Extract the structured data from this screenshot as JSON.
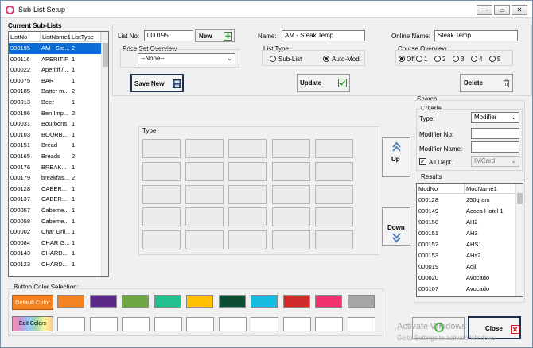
{
  "window": {
    "title": "Sub-List Setup",
    "controls": [
      "—",
      "▭",
      "✕"
    ]
  },
  "sublists": {
    "title": "Current Sub-Lists",
    "columns": [
      "ListNo",
      "ListName1",
      "ListType"
    ],
    "rows": [
      {
        "no": "000195",
        "name": "AM - Ste...",
        "type": "2",
        "selected": true
      },
      {
        "no": "000116",
        "name": "APERITIF",
        "type": "1"
      },
      {
        "no": "000022",
        "name": "Aperitif /...",
        "type": "1"
      },
      {
        "no": "000075",
        "name": "BAR",
        "type": "1"
      },
      {
        "no": "000185",
        "name": "Batter m...",
        "type": "2"
      },
      {
        "no": "000013",
        "name": "Beer",
        "type": "1"
      },
      {
        "no": "000186",
        "name": "Ben Imp...",
        "type": "2"
      },
      {
        "no": "000031",
        "name": "Bourbons",
        "type": "1"
      },
      {
        "no": "000103",
        "name": "BOURB...",
        "type": "1"
      },
      {
        "no": "000151",
        "name": "Bread",
        "type": "1"
      },
      {
        "no": "000165",
        "name": "Breads",
        "type": "2"
      },
      {
        "no": "000176",
        "name": "BREAK...",
        "type": "1"
      },
      {
        "no": "000179",
        "name": "breakfas...",
        "type": "2"
      },
      {
        "no": "000128",
        "name": "CABER...",
        "type": "1"
      },
      {
        "no": "000137",
        "name": "CABER...",
        "type": "1"
      },
      {
        "no": "000057",
        "name": "Cabeme...",
        "type": "1"
      },
      {
        "no": "000058",
        "name": "Cabeme...",
        "type": "1"
      },
      {
        "no": "000002",
        "name": "Char Gril...",
        "type": "1"
      },
      {
        "no": "000084",
        "name": "CHAR G...",
        "type": "1"
      },
      {
        "no": "000143",
        "name": "CHARD...",
        "type": "1"
      },
      {
        "no": "000123",
        "name": "CHARD...",
        "type": "1"
      }
    ]
  },
  "form": {
    "list_no_label": "List No:",
    "list_no_value": "000195",
    "new_label": "New",
    "name_label": "Name:",
    "name_value": "AM - Steak Temp",
    "online_name_label": "Online Name:",
    "online_name_value": "Steak Temp",
    "price_set_label": "Price Set Overview",
    "price_set_value": "--None--",
    "list_type_label": "List Type",
    "list_type_options": [
      "Sub-List",
      "Auto-Modi"
    ],
    "list_type_selected": "Auto-Modi",
    "course_label": "Course Overview",
    "course_options": [
      "Off",
      "1",
      "2",
      "3",
      "4",
      "5"
    ],
    "course_selected": "Off"
  },
  "buttons": {
    "save_new": "Save New",
    "update": "Update",
    "delete": "Delete",
    "up": "Up",
    "down": "Down",
    "close": "Close"
  },
  "type_grid": {
    "label": "Type"
  },
  "search": {
    "title": "Search",
    "criteria_label": "Criteria",
    "type_label": "Type:",
    "type_value": "Modifier",
    "modifier_no_label": "Modifier No:",
    "modifier_name_label": "Modifier Name:",
    "all_dept_label": "All Dept.",
    "all_dept_checked": true,
    "dept_value": "IMCard"
  },
  "results": {
    "title": "Results",
    "columns": [
      "ModNo",
      "ModName1"
    ],
    "rows": [
      {
        "no": "000128",
        "name": "250gram"
      },
      {
        "no": "000149",
        "name": "Acoca Hotel 1"
      },
      {
        "no": "000150",
        "name": "AH2"
      },
      {
        "no": "000151",
        "name": "AH3"
      },
      {
        "no": "000152",
        "name": "AHS1"
      },
      {
        "no": "000153",
        "name": "AHs2"
      },
      {
        "no": "000019",
        "name": "Aoili"
      },
      {
        "no": "000020",
        "name": "Avocado"
      },
      {
        "no": "000107",
        "name": "Avocado"
      }
    ]
  },
  "colors": {
    "label": "Button Color Selection:",
    "default_label": "Default Color",
    "edit_label": "Edit Colors",
    "swatches": [
      "#f58220",
      "#5b2a86",
      "#6ea644",
      "#22bf8f",
      "#ffc000",
      "#0d4d32",
      "#17bde0",
      "#d12c2c",
      "#f0326e",
      "#a6a6a6"
    ]
  },
  "watermark": {
    "line1": "Activate Windows",
    "line2": "Go to Settings to activate Windows."
  }
}
